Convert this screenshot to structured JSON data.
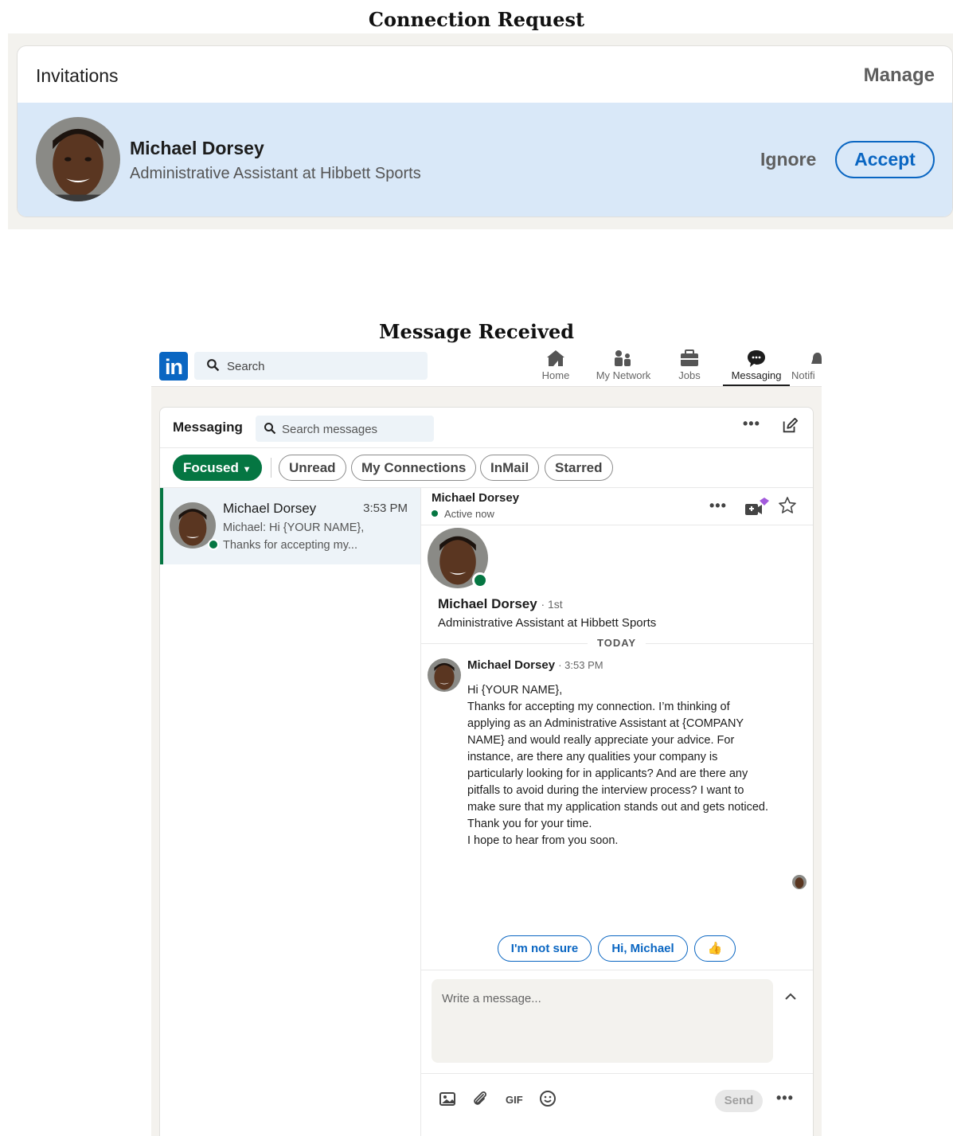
{
  "captions": {
    "top": "Connection Request",
    "bottom": "Message Received"
  },
  "invitations": {
    "title": "Invitations",
    "manage_label": "Manage",
    "request": {
      "name": "Michael Dorsey",
      "headline": "Administrative Assistant at Hibbett Sports",
      "ignore_label": "Ignore",
      "accept_label": "Accept"
    }
  },
  "nav": {
    "logo": "in",
    "search_placeholder": "Search",
    "items": [
      {
        "label": "Home",
        "icon": "home-icon"
      },
      {
        "label": "My Network",
        "icon": "network-icon"
      },
      {
        "label": "Jobs",
        "icon": "briefcase-icon"
      },
      {
        "label": "Messaging",
        "icon": "messaging-icon",
        "active": true
      },
      {
        "label": "Notifi",
        "icon": "bell-icon"
      }
    ]
  },
  "messaging": {
    "title": "Messaging",
    "search_placeholder": "Search messages",
    "filters": [
      "Focused",
      "Unread",
      "My Connections",
      "InMail",
      "Starred"
    ],
    "conversation": {
      "name": "Michael Dorsey",
      "time": "3:53 PM",
      "preview": "Michael: Hi {YOUR NAME}, Thanks for accepting my..."
    },
    "thread": {
      "name": "Michael Dorsey",
      "status": "Active now",
      "profile_name": "Michael Dorsey",
      "degree": "· 1st",
      "profile_headline": "Administrative Assistant at Hibbett Sports",
      "divider": "TODAY",
      "message_sender": "Michael Dorsey",
      "message_time": "· 3:53 PM",
      "message_lines": [
        "Hi {YOUR NAME},",
        "Thanks for accepting my connection. I’m thinking of applying as an Administrative Assistant at {COMPANY NAME} and would really appreciate your advice. For instance, are there any qualities your company is particularly looking for in applicants? And are there any pitfalls to avoid during the interview process? I want to make sure that my application stands out and gets noticed.",
        "Thank you for your time.",
        "I hope to hear from you soon."
      ],
      "quick_replies": [
        "I'm not sure",
        "Hi, Michael",
        "👍"
      ],
      "compose_placeholder": "Write a message...",
      "gif_label": "GIF",
      "send_label": "Send"
    }
  },
  "colors": {
    "linkedin_blue": "#0a66c2",
    "green": "#057642",
    "invite_row_bg": "#d9e8f8"
  }
}
